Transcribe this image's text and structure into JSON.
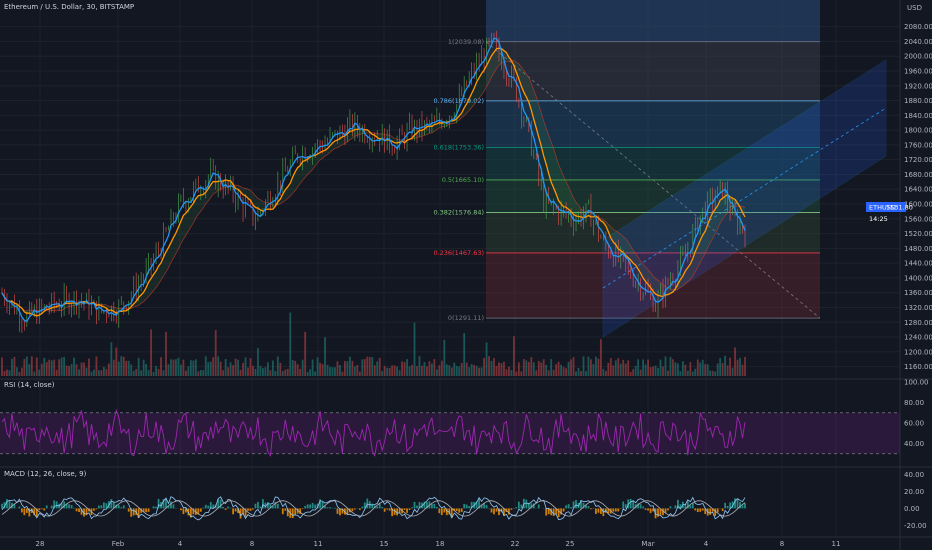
{
  "header": {
    "title": "Ethereum / U.S. Dollar, 30, BITSTAMP",
    "currency": "USD"
  },
  "colors": {
    "background": "#131722",
    "grid": "#1e222d",
    "text": "#b2b5be",
    "fast_ma": "#2196f3",
    "slow_ma": "#ff9800",
    "up": "#4caf50",
    "down": "#ef5350",
    "rsi": "#9c27b0",
    "price_tag": "#2962ff",
    "fib_levels": [
      "#787b86",
      "#f23645",
      "#81c784",
      "#4caf50",
      "#089981",
      "#64b5f6",
      "#787b86"
    ]
  },
  "price_tag": {
    "value": "1531.80",
    "symbol": "ETHUSD",
    "countdown": "14:25"
  },
  "chart_data": [
    {
      "type": "line",
      "name": "price",
      "x_ticks": [
        "28",
        "Feb",
        "4",
        "8",
        "11",
        "15",
        "18",
        "22",
        "25",
        "Mar",
        "4",
        "8",
        "11"
      ],
      "y_ticks": [
        "2080.00",
        "2040.00",
        "2000.00",
        "1960.00",
        "1920.00",
        "1880.00",
        "1840.00",
        "1800.00",
        "1760.00",
        "1720.00",
        "1680.00",
        "1640.00",
        "1600.00",
        "1560.00",
        "1520.00",
        "1480.00",
        "1440.00",
        "1400.00",
        "1360.00",
        "1320.00",
        "1280.00",
        "1240.00",
        "1200.00",
        "1160.00"
      ],
      "ylim": [
        1140,
        2100
      ],
      "anchors": [
        [
          0,
          1360
        ],
        [
          0.03,
          1290
        ],
        [
          0.06,
          1320
        ],
        [
          0.1,
          1345
        ],
        [
          0.13,
          1310
        ],
        [
          0.16,
          1320
        ],
        [
          0.2,
          1430
        ],
        [
          0.24,
          1600
        ],
        [
          0.28,
          1680
        ],
        [
          0.31,
          1630
        ],
        [
          0.34,
          1560
        ],
        [
          0.37,
          1650
        ],
        [
          0.4,
          1740
        ],
        [
          0.43,
          1760
        ],
        [
          0.47,
          1810
        ],
        [
          0.5,
          1790
        ],
        [
          0.53,
          1760
        ],
        [
          0.55,
          1800
        ],
        [
          0.58,
          1810
        ],
        [
          0.61,
          1860
        ],
        [
          0.635,
          1960
        ],
        [
          0.66,
          2039
        ],
        [
          0.69,
          1920
        ],
        [
          0.71,
          1780
        ],
        [
          0.73,
          1600
        ],
        [
          0.75,
          1580
        ],
        [
          0.77,
          1560
        ],
        [
          0.79,
          1580
        ],
        [
          0.81,
          1490
        ],
        [
          0.83,
          1450
        ],
        [
          0.86,
          1380
        ],
        [
          0.88,
          1330
        ],
        [
          0.9,
          1400
        ],
        [
          0.92,
          1460
        ],
        [
          0.94,
          1570
        ],
        [
          0.955,
          1610
        ],
        [
          0.97,
          1640
        ],
        [
          0.985,
          1560
        ],
        [
          1.0,
          1532
        ]
      ],
      "fib_levels": [
        "1(2039.08)",
        "0.786(1879.02)",
        "0.618(1753.36)",
        "0.5(1665.10)",
        "0.382(1576.84)",
        "0.236(1467.63)",
        "0(1291.11)"
      ],
      "fib_values": [
        2039.08,
        1879.02,
        1753.36,
        1665.1,
        1576.84,
        1467.63,
        1291.11
      ]
    },
    {
      "type": "line",
      "name": "RSI (14, close)",
      "y_ticks": [
        "100.00",
        "80.00",
        "60.00",
        "40.00"
      ],
      "ylim": [
        20,
        100
      ],
      "bands": [
        70,
        30
      ]
    },
    {
      "type": "bar",
      "name": "MACD (12, 26, close, 9)",
      "y_ticks": [
        "40.00",
        "20.00",
        "0.00",
        "-20.00"
      ],
      "ylim": [
        -30,
        45
      ]
    }
  ]
}
